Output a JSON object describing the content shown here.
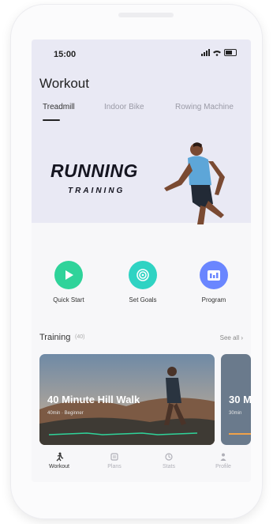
{
  "status_bar": {
    "time": "15:00"
  },
  "header": {
    "title": "Workout"
  },
  "tabs": [
    {
      "label": "Treadmill",
      "active": true
    },
    {
      "label": "Indoor Bike",
      "active": false
    },
    {
      "label": "Rowing Machine",
      "active": false
    }
  ],
  "hero": {
    "title": "RUNNING",
    "subtitle": "TRAINING"
  },
  "quick_actions": [
    {
      "label": "Quick Start",
      "icon": "play-icon",
      "color": "#2fd39a"
    },
    {
      "label": "Set Goals",
      "icon": "target-icon",
      "color": "#2fd3c3"
    },
    {
      "label": "Program",
      "icon": "calendar-icon",
      "color": "#6a86ff"
    }
  ],
  "training": {
    "title": "Training",
    "count": "(40)",
    "see_all": "See all",
    "cards": [
      {
        "title": "40 Minute Hill Walk",
        "meta": "40min · Beginner"
      },
      {
        "title": "30 M",
        "meta": "30min"
      }
    ]
  },
  "bottom_nav": [
    {
      "label": "Workout",
      "icon": "runner-icon",
      "active": true
    },
    {
      "label": "Plans",
      "icon": "plans-icon",
      "active": false
    },
    {
      "label": "Stats",
      "icon": "stats-icon",
      "active": false
    },
    {
      "label": "Profile",
      "icon": "person-icon",
      "active": false
    }
  ],
  "colors": {
    "hero_background": "#e9e9f4",
    "accent_green": "#2fd39a"
  }
}
